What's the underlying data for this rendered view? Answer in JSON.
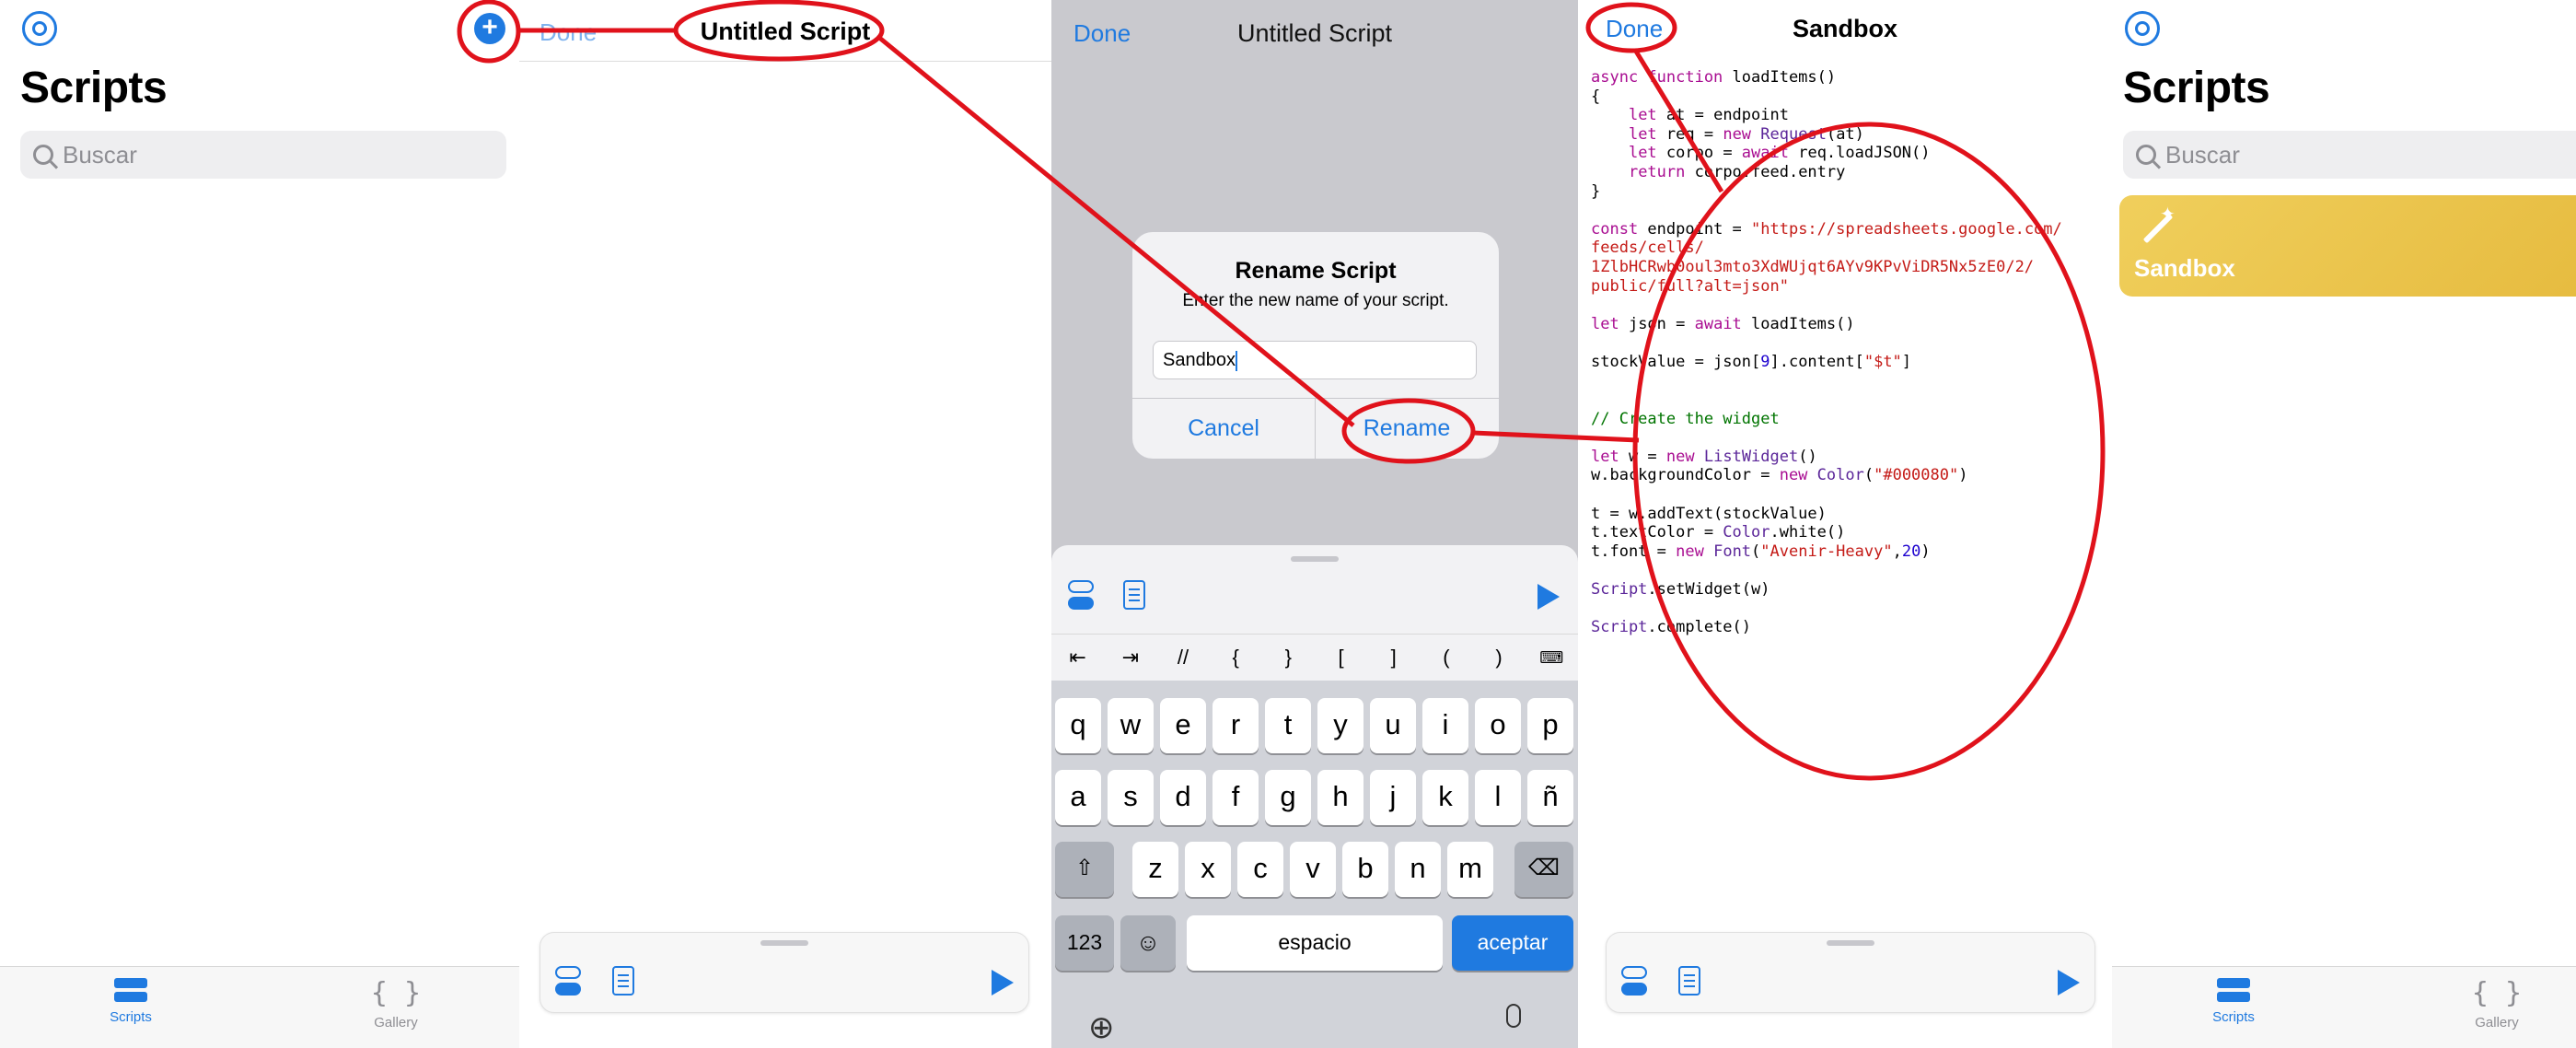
{
  "panel1": {
    "title": "Scripts",
    "search_placeholder": "Buscar",
    "tabs": [
      {
        "label": "Scripts",
        "active": true
      },
      {
        "label": "Gallery",
        "active": false
      }
    ],
    "add_button": "+"
  },
  "panel2": {
    "done": "Done",
    "title": "Untitled Script"
  },
  "panel3": {
    "done": "Done",
    "title": "Untitled Script",
    "alert": {
      "title": "Rename Script",
      "message": "Enter the new name of your script.",
      "input_value": "Sandbox",
      "cancel": "Cancel",
      "confirm": "Rename"
    },
    "symbols": [
      "⇤",
      "⇥",
      "//",
      "{",
      "}",
      "[",
      "]",
      "(",
      ")"
    ],
    "keyboard": {
      "row1": [
        "q",
        "w",
        "e",
        "r",
        "t",
        "y",
        "u",
        "i",
        "o",
        "p"
      ],
      "row2": [
        "a",
        "s",
        "d",
        "f",
        "g",
        "h",
        "j",
        "k",
        "l",
        "ñ"
      ],
      "row3": [
        "z",
        "x",
        "c",
        "v",
        "b",
        "n",
        "m"
      ],
      "numbers_key": "123",
      "space_key": "espacio",
      "return_key": "aceptar"
    }
  },
  "panel4": {
    "done": "Done",
    "title": "Sandbox",
    "code_lines": [
      "async function loadItems()",
      "{",
      "    let at = endpoint",
      "    let req = new Request(at)",
      "    let corpo = await req.loadJSON()",
      "    return corpo.feed.entry",
      "}",
      "",
      "const endpoint = \"https://spreadsheets.google.com/",
      "feeds/cells/",
      "1ZlbHCRwb0oul3mto3XdWUjqt6AYv9KPvViDR5Nx5zE0/2/",
      "public/full?alt=json\"",
      "",
      "let json = await loadItems()",
      "",
      "stockValue = json[9].content[\"$t\"]",
      "",
      "",
      "// Create the widget",
      "",
      "let w = new ListWidget()",
      "w.backgroundColor = new Color(\"#000080\")",
      "",
      "t = w.addText(stockValue)",
      "t.textColor = Color.white()",
      "t.font = new Font(\"Avenir-Heavy\",20)",
      "",
      "Script.setWidget(w)",
      "",
      "Script.complete()"
    ]
  },
  "panel5": {
    "title": "Scripts",
    "search_placeholder": "Buscar",
    "card_title": "Sandbox",
    "tabs": [
      {
        "label": "Scripts",
        "active": true
      },
      {
        "label": "Gallery",
        "active": false
      }
    ]
  },
  "colors": {
    "accent": "#1f7ae0",
    "annotation": "#e0121b",
    "card": "#ebc24a"
  },
  "icons": [
    "gear-icon",
    "plus-icon",
    "search-icon",
    "scripts-tab-icon",
    "gallery-tab-icon",
    "toggles-icon",
    "document-icon",
    "play-icon",
    "globe-icon",
    "microphone-icon",
    "shift-icon",
    "delete-icon",
    "emoji-icon",
    "keyboard-dismiss-icon",
    "wand-icon"
  ]
}
